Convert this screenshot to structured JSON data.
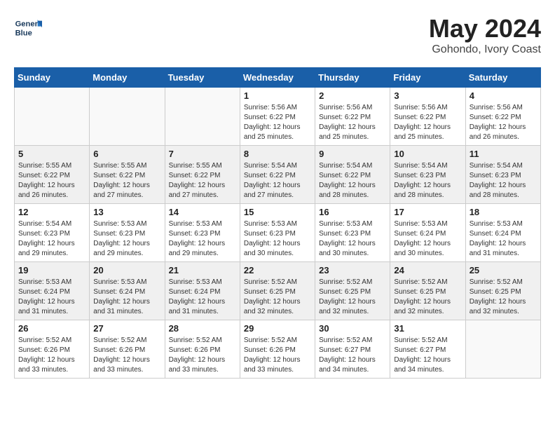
{
  "header": {
    "logo_line1": "General",
    "logo_line2": "Blue",
    "month_year": "May 2024",
    "location": "Gohondo, Ivory Coast"
  },
  "weekdays": [
    "Sunday",
    "Monday",
    "Tuesday",
    "Wednesday",
    "Thursday",
    "Friday",
    "Saturday"
  ],
  "weeks": [
    [
      {
        "day": "",
        "detail": ""
      },
      {
        "day": "",
        "detail": ""
      },
      {
        "day": "",
        "detail": ""
      },
      {
        "day": "1",
        "detail": "Sunrise: 5:56 AM\nSunset: 6:22 PM\nDaylight: 12 hours\nand 25 minutes."
      },
      {
        "day": "2",
        "detail": "Sunrise: 5:56 AM\nSunset: 6:22 PM\nDaylight: 12 hours\nand 25 minutes."
      },
      {
        "day": "3",
        "detail": "Sunrise: 5:56 AM\nSunset: 6:22 PM\nDaylight: 12 hours\nand 25 minutes."
      },
      {
        "day": "4",
        "detail": "Sunrise: 5:56 AM\nSunset: 6:22 PM\nDaylight: 12 hours\nand 26 minutes."
      }
    ],
    [
      {
        "day": "5",
        "detail": "Sunrise: 5:55 AM\nSunset: 6:22 PM\nDaylight: 12 hours\nand 26 minutes."
      },
      {
        "day": "6",
        "detail": "Sunrise: 5:55 AM\nSunset: 6:22 PM\nDaylight: 12 hours\nand 27 minutes."
      },
      {
        "day": "7",
        "detail": "Sunrise: 5:55 AM\nSunset: 6:22 PM\nDaylight: 12 hours\nand 27 minutes."
      },
      {
        "day": "8",
        "detail": "Sunrise: 5:54 AM\nSunset: 6:22 PM\nDaylight: 12 hours\nand 27 minutes."
      },
      {
        "day": "9",
        "detail": "Sunrise: 5:54 AM\nSunset: 6:22 PM\nDaylight: 12 hours\nand 28 minutes."
      },
      {
        "day": "10",
        "detail": "Sunrise: 5:54 AM\nSunset: 6:23 PM\nDaylight: 12 hours\nand 28 minutes."
      },
      {
        "day": "11",
        "detail": "Sunrise: 5:54 AM\nSunset: 6:23 PM\nDaylight: 12 hours\nand 28 minutes."
      }
    ],
    [
      {
        "day": "12",
        "detail": "Sunrise: 5:54 AM\nSunset: 6:23 PM\nDaylight: 12 hours\nand 29 minutes."
      },
      {
        "day": "13",
        "detail": "Sunrise: 5:53 AM\nSunset: 6:23 PM\nDaylight: 12 hours\nand 29 minutes."
      },
      {
        "day": "14",
        "detail": "Sunrise: 5:53 AM\nSunset: 6:23 PM\nDaylight: 12 hours\nand 29 minutes."
      },
      {
        "day": "15",
        "detail": "Sunrise: 5:53 AM\nSunset: 6:23 PM\nDaylight: 12 hours\nand 30 minutes."
      },
      {
        "day": "16",
        "detail": "Sunrise: 5:53 AM\nSunset: 6:23 PM\nDaylight: 12 hours\nand 30 minutes."
      },
      {
        "day": "17",
        "detail": "Sunrise: 5:53 AM\nSunset: 6:24 PM\nDaylight: 12 hours\nand 30 minutes."
      },
      {
        "day": "18",
        "detail": "Sunrise: 5:53 AM\nSunset: 6:24 PM\nDaylight: 12 hours\nand 31 minutes."
      }
    ],
    [
      {
        "day": "19",
        "detail": "Sunrise: 5:53 AM\nSunset: 6:24 PM\nDaylight: 12 hours\nand 31 minutes."
      },
      {
        "day": "20",
        "detail": "Sunrise: 5:53 AM\nSunset: 6:24 PM\nDaylight: 12 hours\nand 31 minutes."
      },
      {
        "day": "21",
        "detail": "Sunrise: 5:53 AM\nSunset: 6:24 PM\nDaylight: 12 hours\nand 31 minutes."
      },
      {
        "day": "22",
        "detail": "Sunrise: 5:52 AM\nSunset: 6:25 PM\nDaylight: 12 hours\nand 32 minutes."
      },
      {
        "day": "23",
        "detail": "Sunrise: 5:52 AM\nSunset: 6:25 PM\nDaylight: 12 hours\nand 32 minutes."
      },
      {
        "day": "24",
        "detail": "Sunrise: 5:52 AM\nSunset: 6:25 PM\nDaylight: 12 hours\nand 32 minutes."
      },
      {
        "day": "25",
        "detail": "Sunrise: 5:52 AM\nSunset: 6:25 PM\nDaylight: 12 hours\nand 32 minutes."
      }
    ],
    [
      {
        "day": "26",
        "detail": "Sunrise: 5:52 AM\nSunset: 6:26 PM\nDaylight: 12 hours\nand 33 minutes."
      },
      {
        "day": "27",
        "detail": "Sunrise: 5:52 AM\nSunset: 6:26 PM\nDaylight: 12 hours\nand 33 minutes."
      },
      {
        "day": "28",
        "detail": "Sunrise: 5:52 AM\nSunset: 6:26 PM\nDaylight: 12 hours\nand 33 minutes."
      },
      {
        "day": "29",
        "detail": "Sunrise: 5:52 AM\nSunset: 6:26 PM\nDaylight: 12 hours\nand 33 minutes."
      },
      {
        "day": "30",
        "detail": "Sunrise: 5:52 AM\nSunset: 6:27 PM\nDaylight: 12 hours\nand 34 minutes."
      },
      {
        "day": "31",
        "detail": "Sunrise: 5:52 AM\nSunset: 6:27 PM\nDaylight: 12 hours\nand 34 minutes."
      },
      {
        "day": "",
        "detail": ""
      }
    ]
  ]
}
